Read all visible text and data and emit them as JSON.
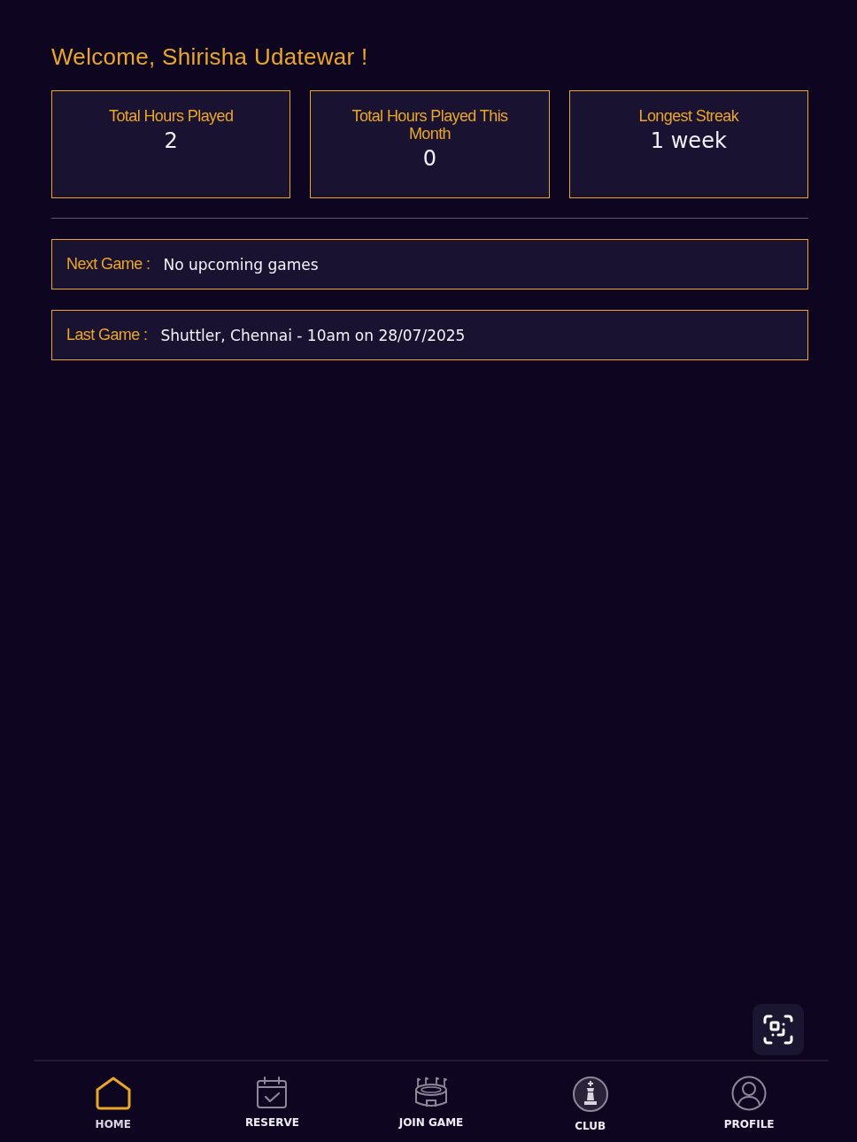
{
  "greeting": "Welcome, Shirisha Udatewar !",
  "stats": [
    {
      "title": "Total Hours Played",
      "value": "2"
    },
    {
      "title": "Total Hours Played This Month",
      "value": "0"
    },
    {
      "title": "Longest Streak",
      "value": "1 week"
    }
  ],
  "games": [
    {
      "label": "Next Game :",
      "value": "No upcoming games"
    },
    {
      "label": "Last Game :",
      "value": "Shuttler, Chennai - 10am on 28/07/2025"
    }
  ],
  "nav": {
    "items": [
      {
        "label": "HOME",
        "selected": true
      },
      {
        "label": "RESERVE",
        "selected": false
      },
      {
        "label": "JOIN GAME",
        "selected": false
      },
      {
        "label": "CLUB",
        "selected": false
      },
      {
        "label": "PROFILE",
        "selected": false
      }
    ]
  }
}
